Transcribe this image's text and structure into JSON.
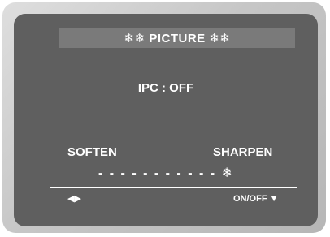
{
  "menu": {
    "title": "❄❄  PICTURE  ❄❄",
    "ipc_status": "IPC : OFF",
    "soften_label": "SOFTEN",
    "sharpen_label": "SHARPEN",
    "slider_track": "- - - - - - - - - - - ❄",
    "nav_arrows": "◀▶",
    "onoff_hint": "ON/OFF ▼"
  }
}
